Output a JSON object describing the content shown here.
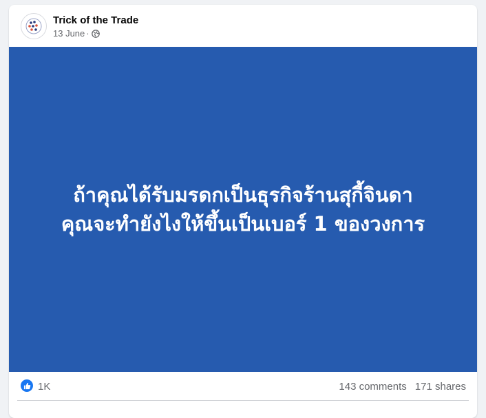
{
  "post": {
    "author": "Trick of the Trade",
    "date": "13 June",
    "separator": "·",
    "privacy_icon": "globe-icon",
    "image_lines": [
      "ถ้าคุณได้รับมรดกเป็นธุรกิจร้านสุกี้จินดา",
      "คุณจะทำยังไงให้ขึ้นเป็นเบอร์ 1 ของวงการ"
    ],
    "image_background": "#265baf",
    "reactions": {
      "icon": "like-icon",
      "count": "1K"
    },
    "comments": "143 comments",
    "shares": "171 shares"
  }
}
